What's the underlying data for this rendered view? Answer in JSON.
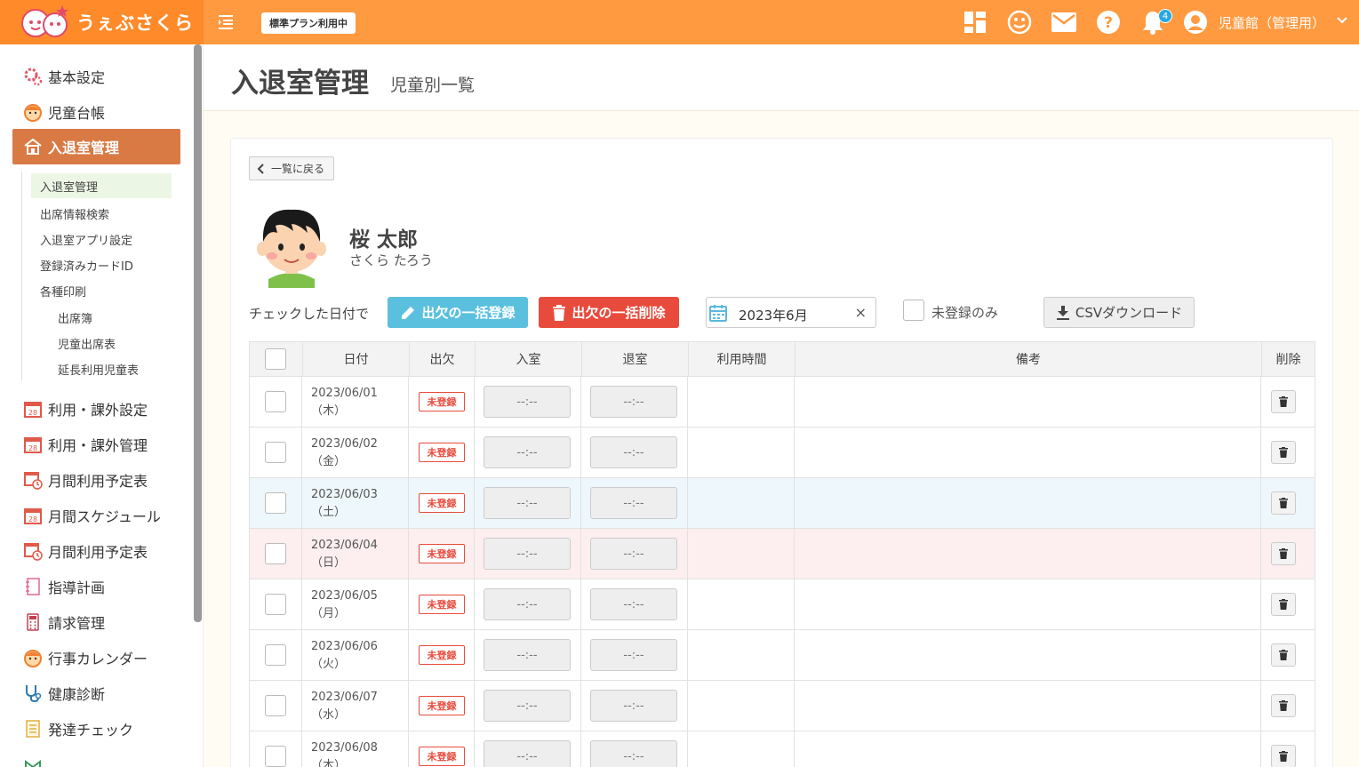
{
  "header": {
    "logo_text": "うぇぶさくら",
    "plan_badge": "標準プラン利用中",
    "notification_count": "4",
    "user_name": "児童館（管理用）"
  },
  "sidebar": {
    "items": [
      {
        "label": "基本設定",
        "icon": "gear-icon"
      },
      {
        "label": "児童台帳",
        "icon": "child-face-icon"
      },
      {
        "label": "入退室管理",
        "icon": "house-icon"
      },
      {
        "label": "利用・課外設定",
        "icon": "calendar-icon"
      },
      {
        "label": "利用・課外管理",
        "icon": "calendar-icon"
      },
      {
        "label": "月間利用予定表",
        "icon": "calendar-clock-icon"
      },
      {
        "label": "月間スケジュール",
        "icon": "calendar-icon"
      },
      {
        "label": "月間利用予定表",
        "icon": "calendar-clock-icon"
      },
      {
        "label": "指導計画",
        "icon": "notebook-icon"
      },
      {
        "label": "請求管理",
        "icon": "calculator-icon"
      },
      {
        "label": "行事カレンダー",
        "icon": "child-face-icon"
      },
      {
        "label": "健康診断",
        "icon": "stethoscope-icon"
      },
      {
        "label": "発達チェック",
        "icon": "checklist-icon"
      }
    ],
    "subitems": {
      "current": "入退室管理",
      "search": "出席情報検索",
      "app_settings": "入退室アプリ設定",
      "card_id": "登録済みカードID",
      "print": "各種印刷",
      "print_attendance": "出席簿",
      "print_child_attendance": "児童出席表",
      "print_extended": "延長利用児童表"
    }
  },
  "page": {
    "title": "入退室管理",
    "subtitle": "児童別一覧",
    "back_label": "一覧に戻る",
    "child_name": "桜 太郎",
    "child_kana": "さくら たろう",
    "check_label": "チェックした日付で",
    "bulk_register": "出欠の一括登録",
    "bulk_delete": "出欠の一括削除",
    "month_value": "2023年6月",
    "clear_symbol": "×",
    "unregistered_only": "未登録のみ",
    "csv_download": "CSVダウンロード"
  },
  "table": {
    "headers": {
      "date": "日付",
      "attendance": "出欠",
      "in": "入室",
      "out": "退室",
      "usage": "利用時間",
      "note": "備考",
      "delete": "削除"
    },
    "rows": [
      {
        "date": "2023/06/01",
        "dow": "（木）",
        "status": "未登録",
        "in": "--:--",
        "out": "--:--"
      },
      {
        "date": "2023/06/02",
        "dow": "（金）",
        "status": "未登録",
        "in": "--:--",
        "out": "--:--"
      },
      {
        "date": "2023/06/03",
        "dow": "（土）",
        "status": "未登録",
        "in": "--:--",
        "out": "--:--"
      },
      {
        "date": "2023/06/04",
        "dow": "（日）",
        "status": "未登録",
        "in": "--:--",
        "out": "--:--"
      },
      {
        "date": "2023/06/05",
        "dow": "（月）",
        "status": "未登録",
        "in": "--:--",
        "out": "--:--"
      },
      {
        "date": "2023/06/06",
        "dow": "（火）",
        "status": "未登録",
        "in": "--:--",
        "out": "--:--"
      },
      {
        "date": "2023/06/07",
        "dow": "（水）",
        "status": "未登録",
        "in": "--:--",
        "out": "--:--"
      },
      {
        "date": "2023/06/08",
        "dow": "（木）",
        "status": "未登録",
        "in": "--:--",
        "out": "--:--"
      }
    ]
  },
  "colors": {
    "header": "#ff9a40",
    "active_nav": "#d97a45",
    "bulk_register": "#5bc0de",
    "bulk_delete": "#e84b3c",
    "saturday_row": "#eef7fb",
    "sunday_row": "#fdeef0"
  }
}
